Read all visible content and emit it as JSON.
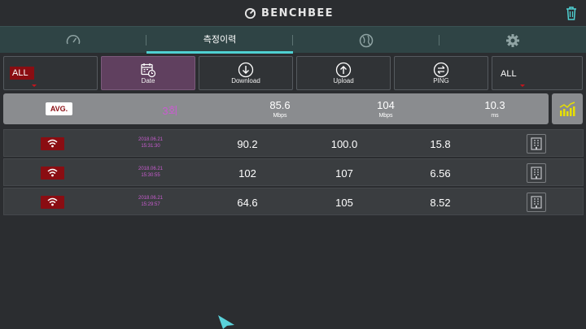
{
  "header": {
    "app_name": "BENCHBEE"
  },
  "tabs": [
    {
      "icon": "speedometer-icon",
      "label": ""
    },
    {
      "icon": "",
      "label": "측정이력",
      "active": true
    },
    {
      "icon": "globe-icon",
      "label": ""
    },
    {
      "icon": "gear-icon",
      "label": ""
    }
  ],
  "filters": {
    "network": "ALL",
    "date": "Date",
    "download": "Download",
    "upload": "Upload",
    "ping": "PING",
    "location": "ALL"
  },
  "average": {
    "badge": "AVG.",
    "count": "3회",
    "download": "85.6",
    "download_unit": "Mbps",
    "upload": "104",
    "upload_unit": "Mbps",
    "ping": "10.3",
    "ping_unit": "ms"
  },
  "rows": [
    {
      "date": "2018.06.21",
      "time": "15:31:30",
      "download": "90.2",
      "upload": "100.0",
      "ping": "15.8"
    },
    {
      "date": "2018.06.21",
      "time": "15:30:55",
      "download": "102",
      "upload": "107",
      "ping": "6.56"
    },
    {
      "date": "2018.06.21",
      "time": "15:29:57",
      "download": "64.6",
      "upload": "105",
      "ping": "8.52"
    }
  ],
  "colors": {
    "accent": "#4fd0d2",
    "badge_red": "#8a0d12",
    "date_magenta": "#c95cd0",
    "chart_yellow": "#e8e000"
  }
}
